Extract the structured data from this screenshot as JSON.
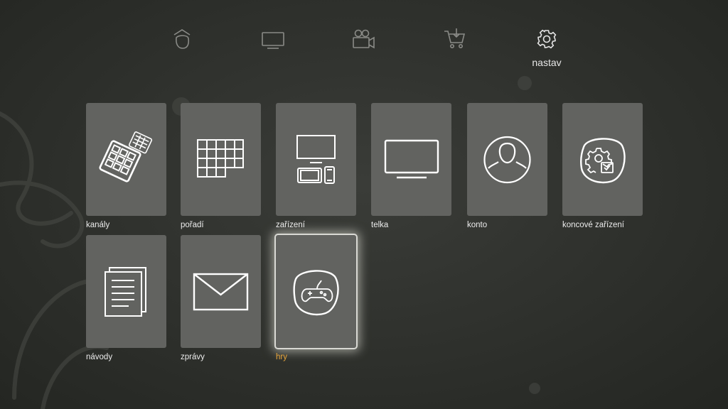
{
  "nav": {
    "items": [
      {
        "icon": "home-icon",
        "label": ""
      },
      {
        "icon": "tv-icon",
        "label": ""
      },
      {
        "icon": "video-camera-icon",
        "label": ""
      },
      {
        "icon": "cart-icon",
        "label": ""
      },
      {
        "icon": "gear-icon",
        "label": "nastav",
        "active": true
      }
    ]
  },
  "tiles": [
    {
      "label": "kanály",
      "icon": "remote-keypad-icon"
    },
    {
      "label": "pořadí",
      "icon": "grid-icon"
    },
    {
      "label": "zařízení",
      "icon": "devices-icon"
    },
    {
      "label": "telka",
      "icon": "tv-screen-icon"
    },
    {
      "label": "konto",
      "icon": "user-account-icon"
    },
    {
      "label": "koncové zařízení",
      "icon": "device-settings-icon"
    },
    {
      "label": "návody",
      "icon": "documents-icon"
    },
    {
      "label": "zprávy",
      "icon": "envelope-icon"
    },
    {
      "label": "hry",
      "icon": "gamepad-icon",
      "focused": true
    }
  ],
  "colors": {
    "accent": "#e7a43a",
    "tile": "#626360",
    "background": "#2f312d"
  }
}
